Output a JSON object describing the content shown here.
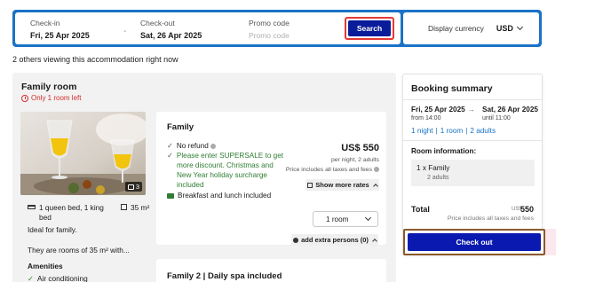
{
  "search": {
    "checkin_label": "Check-in",
    "checkin_value": "Fri, 25 Apr 2025",
    "separator": "-",
    "checkout_label": "Check-out",
    "checkout_value": "Sat, 26 Apr 2025",
    "promo_label": "Promo code",
    "promo_placeholder": "Promo code",
    "search_button": "Search",
    "currency_label": "Display currency",
    "currency_value": "USD",
    "bar_color": "#1a73c6",
    "button_color": "#0a1c9a"
  },
  "viewers_text": "2 others viewing this accommodation right now",
  "room": {
    "title": "Family room",
    "availability": "Only 1 room left",
    "photo_count": "3",
    "bed": "1 queen bed, 1 king bed",
    "size": "35 m²",
    "description_1": "Ideal for family.",
    "description_2": "They are rooms of 35 m² with...",
    "amenities_label": "Amenities",
    "amenity_1": "Air conditioning"
  },
  "rate": {
    "title": "Family",
    "no_refund": "No refund",
    "promo_line_1": "Please enter SUPERSALE to get",
    "promo_line_2": "more discount. Christmas and",
    "promo_line_3": "New Year holiday surcharge",
    "promo_line_4": "included",
    "meals": "Breakfast and lunch included",
    "price": "US$ 550",
    "per_night": "per night, 2 adults",
    "taxes": "Price includes all taxes and fees",
    "show_more": "Show more rates",
    "room_select": "1 room",
    "extra_persons": "add extra persons (0)"
  },
  "rate2": {
    "title": "Family 2 | Daily spa included"
  },
  "summary": {
    "title": "Booking summary",
    "checkin_date": "Fri, 25 Apr 2025",
    "checkin_time": "from 14:00",
    "arrow": "→",
    "checkout_date": "Sat, 26 Apr 2025",
    "checkout_time": "until 11:00",
    "nights": "1 night",
    "rooms": "1 room",
    "adults": "2 adults",
    "link_sep": "|",
    "room_info_label": "Room information:",
    "room_line": "1 x Family",
    "room_guests": "2 adults",
    "total_label": "Total",
    "total_currency": "US$",
    "total_value": "550",
    "total_note": "Price includes all taxes and fees",
    "checkout_button": "Check out",
    "button_color": "#0a1ab0"
  }
}
